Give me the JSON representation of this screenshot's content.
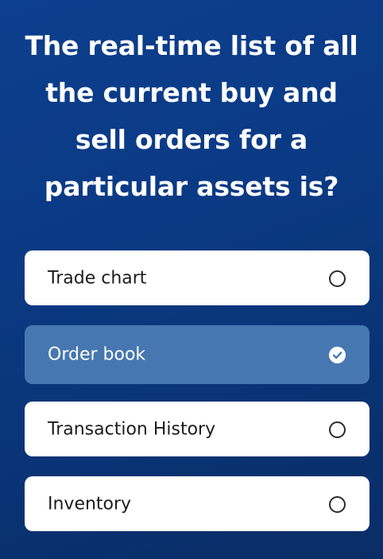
{
  "question": {
    "lines": [
      "The real-time list of all",
      "the current buy and",
      "sell orders for a",
      "particular assets is?"
    ]
  },
  "options": [
    {
      "label": "Trade chart",
      "selected": false,
      "icon": "radio-empty-icon"
    },
    {
      "label": "Order book",
      "selected": true,
      "icon": "check-circle-icon"
    },
    {
      "label": "Transaction History",
      "selected": false,
      "icon": "radio-empty-icon"
    },
    {
      "label": "Inventory",
      "selected": false,
      "icon": "radio-empty-icon"
    }
  ],
  "colors": {
    "background": "#0b3a84",
    "selected_option": "#4777b0",
    "option": "#ffffff"
  }
}
